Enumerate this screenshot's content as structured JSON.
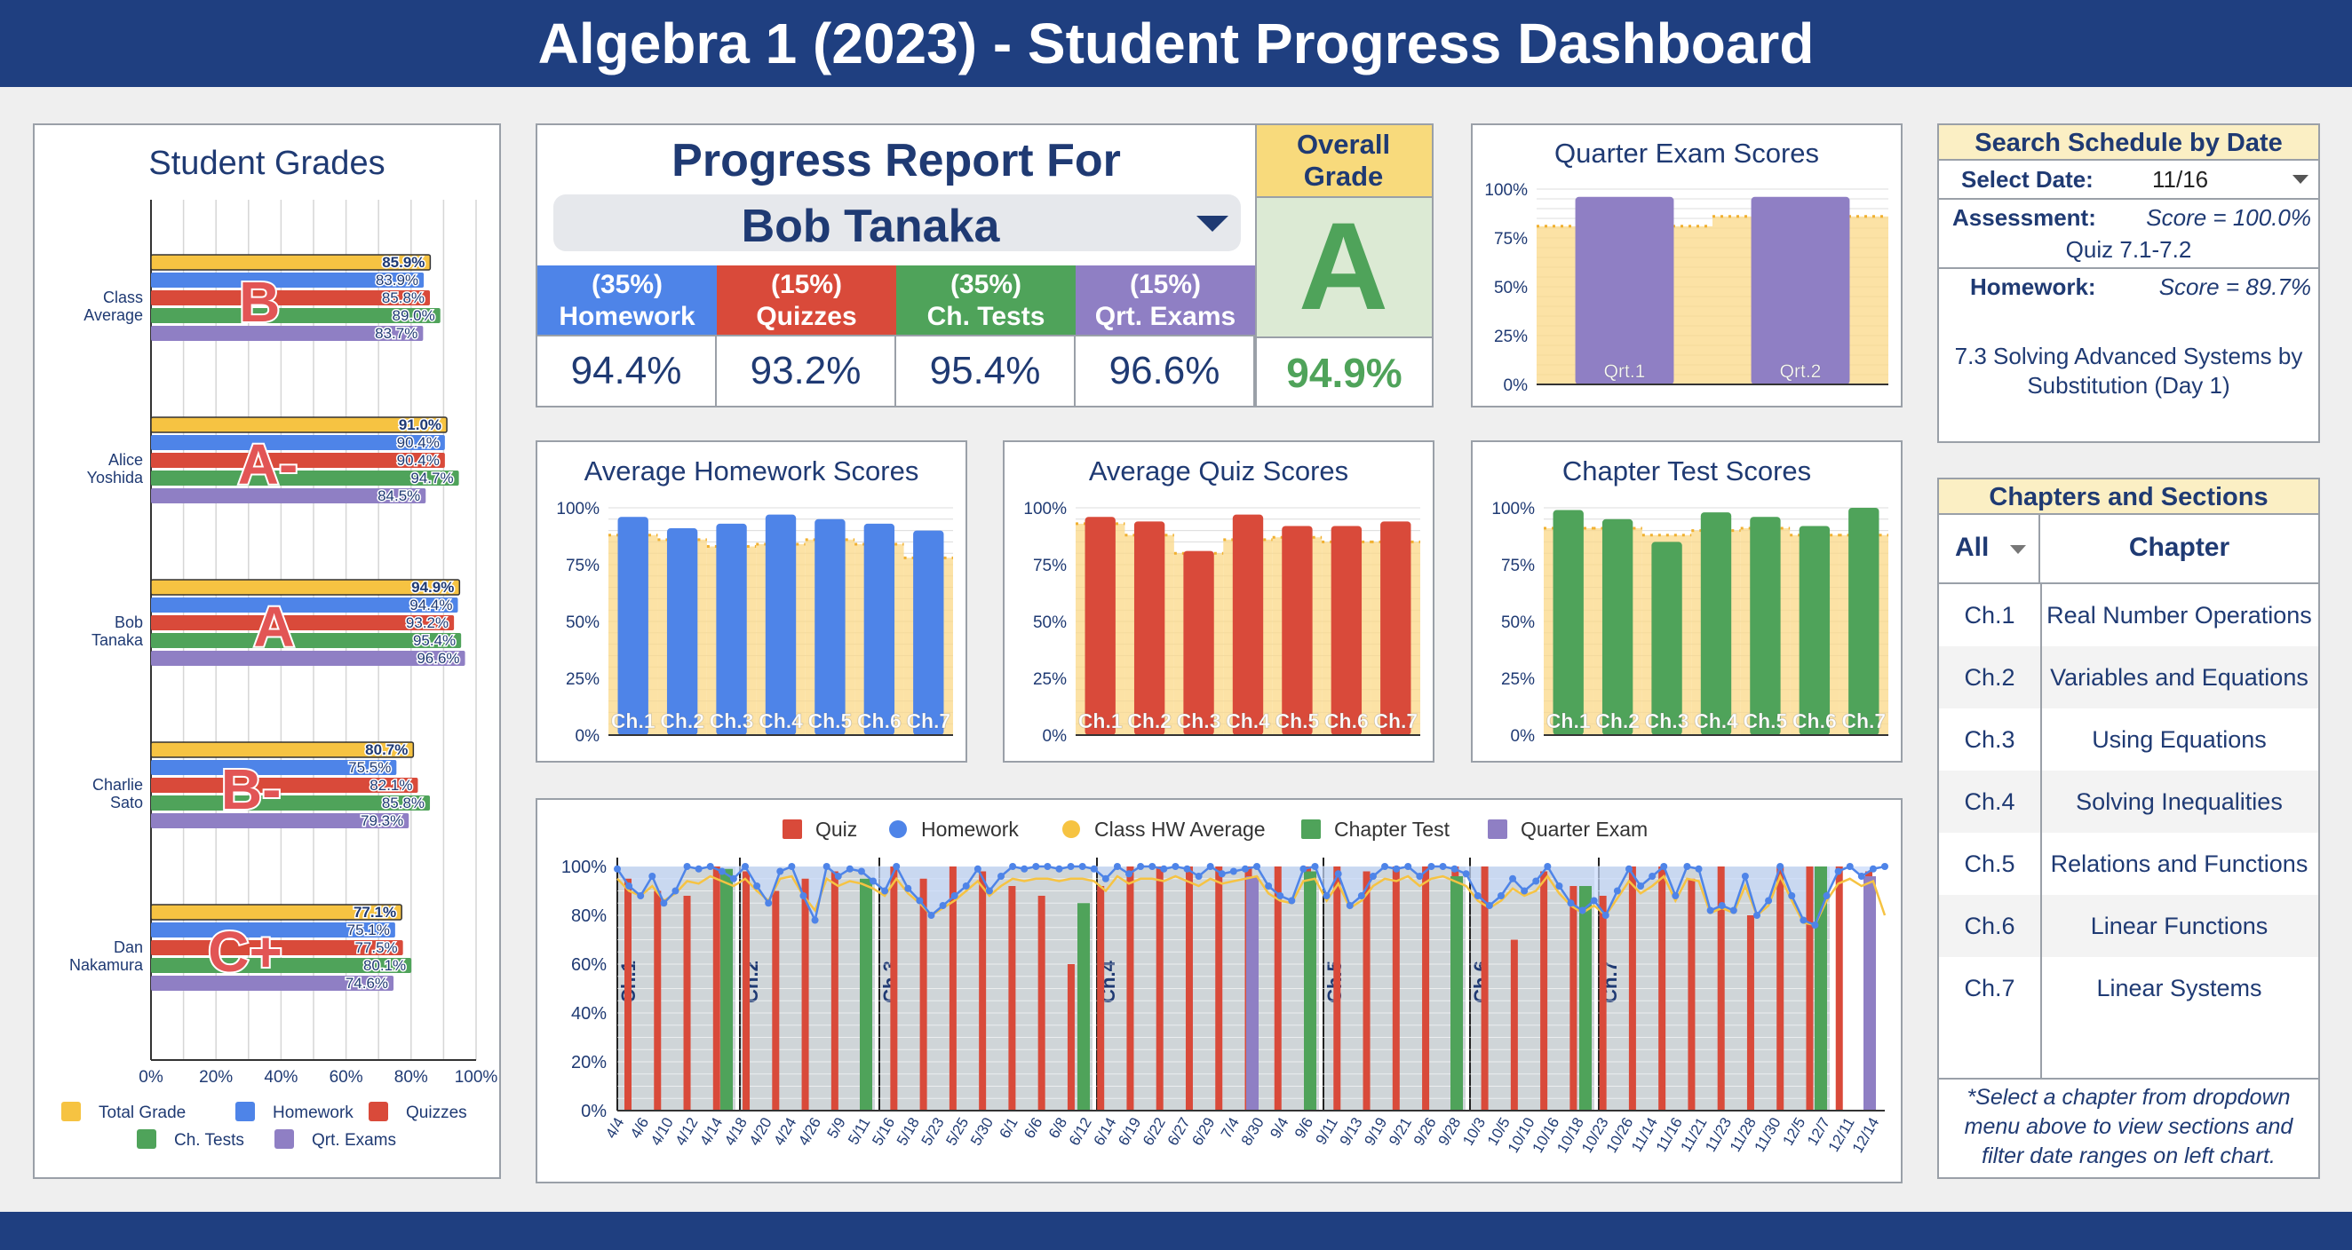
{
  "title": "Algebra 1 (2023) - Student Progress Dashboard",
  "grades_panel": {
    "title": "Student Grades",
    "students": [
      {
        "name": [
          "Class",
          "Average"
        ],
        "letter": "B",
        "values": [
          85.9,
          83.9,
          85.8,
          89.0,
          83.7
        ]
      },
      {
        "name": [
          "Alice",
          "Yoshida"
        ],
        "letter": "A-",
        "values": [
          91.0,
          90.4,
          90.4,
          94.7,
          84.5
        ]
      },
      {
        "name": [
          "Bob",
          "Tanaka"
        ],
        "letter": "A",
        "values": [
          94.9,
          94.4,
          93.2,
          95.4,
          96.6
        ]
      },
      {
        "name": [
          "Charlie",
          "Sato"
        ],
        "letter": "B-",
        "values": [
          80.7,
          75.5,
          82.1,
          85.8,
          79.3
        ]
      },
      {
        "name": [
          "Dan",
          "Nakamura"
        ],
        "letter": "C+",
        "values": [
          77.1,
          75.1,
          77.5,
          80.1,
          74.6
        ]
      }
    ],
    "axis_ticks": [
      "0%",
      "20%",
      "40%",
      "60%",
      "80%",
      "100%"
    ],
    "legend": [
      "Total Grade",
      "Homework",
      "Quizzes",
      "Ch. Tests",
      "Qrt. Exams"
    ]
  },
  "progress": {
    "title": "Progress Report For",
    "student": "Bob Tanaka",
    "overall_label": "Overall Grade",
    "overall_letter": "A",
    "overall_pct": "94.9%",
    "categories": [
      {
        "weight": "(35%)",
        "name": "Homework",
        "pct": "94.4%"
      },
      {
        "weight": "(15%)",
        "name": "Quizzes",
        "pct": "93.2%"
      },
      {
        "weight": "(35%)",
        "name": "Ch. Tests",
        "pct": "95.4%"
      },
      {
        "weight": "(15%)",
        "name": "Qrt. Exams",
        "pct": "96.6%"
      }
    ]
  },
  "schedule": {
    "title": "Search Schedule by Date",
    "select_label": "Select Date:",
    "select_value": "11/16",
    "assessment_label": "Assessment:",
    "assessment_score": "Score = 100.0%",
    "assessment_name": "Quiz 7.1-7.2",
    "homework_label": "Homework:",
    "homework_score": "Score = 89.7%",
    "homework_name": "7.3 Solving Advanced Systems by Substitution (Day 1)"
  },
  "chapters": {
    "title": "Chapters and Sections",
    "filter": "All",
    "col": "Chapter",
    "rows": [
      {
        "id": "Ch.1",
        "name": "Real Number Operations"
      },
      {
        "id": "Ch.2",
        "name": "Variables and Equations"
      },
      {
        "id": "Ch.3",
        "name": "Using Equations"
      },
      {
        "id": "Ch.4",
        "name": "Solving Inequalities"
      },
      {
        "id": "Ch.5",
        "name": "Relations and Functions"
      },
      {
        "id": "Ch.6",
        "name": "Linear Functions"
      },
      {
        "id": "Ch.7",
        "name": "Linear Systems"
      }
    ],
    "note": "*Select a chapter from dropdown menu above to view sections and filter date ranges on left chart."
  },
  "colors": {
    "total": "#f6c342",
    "homework": "#4e84e8",
    "quiz": "#d94a3a",
    "test": "#4fa35a",
    "exam": "#8f7fc4",
    "navy": "#1f3f80"
  },
  "chart_data": [
    {
      "type": "bar",
      "title": "Student Grades",
      "orientation": "horizontal",
      "categories": [
        "Class Average",
        "Alice Yoshida",
        "Bob Tanaka",
        "Charlie Sato",
        "Dan Nakamura"
      ],
      "series": [
        {
          "name": "Total Grade",
          "values": [
            85.9,
            91.0,
            94.9,
            80.7,
            77.1
          ]
        },
        {
          "name": "Homework",
          "values": [
            83.9,
            90.4,
            94.4,
            75.5,
            75.1
          ]
        },
        {
          "name": "Quizzes",
          "values": [
            85.8,
            90.4,
            93.2,
            82.1,
            77.5
          ]
        },
        {
          "name": "Ch. Tests",
          "values": [
            89.0,
            94.7,
            95.4,
            85.8,
            80.1
          ]
        },
        {
          "name": "Qrt. Exams",
          "values": [
            83.7,
            84.5,
            96.6,
            79.3,
            74.6
          ]
        }
      ],
      "xlim": [
        0,
        100
      ]
    },
    {
      "type": "bar",
      "title": "Quarter Exam Scores",
      "categories": [
        "Qrt.1",
        "Qrt.2"
      ],
      "values": [
        96,
        96
      ],
      "class_avg": [
        81,
        86
      ],
      "ylim": [
        0,
        100
      ]
    },
    {
      "type": "bar",
      "title": "Average Homework Scores",
      "categories": [
        "Ch.1",
        "Ch.2",
        "Ch.3",
        "Ch.4",
        "Ch.5",
        "Ch.6",
        "Ch.7"
      ],
      "values": [
        96,
        91,
        93,
        97,
        95,
        93,
        90
      ],
      "class_avg": [
        88,
        86,
        83,
        84,
        86,
        84,
        78
      ],
      "ylim": [
        0,
        100
      ]
    },
    {
      "type": "bar",
      "title": "Average Quiz Scores",
      "categories": [
        "Ch.1",
        "Ch.2",
        "Ch.3",
        "Ch.4",
        "Ch.5",
        "Ch.6",
        "Ch.7"
      ],
      "values": [
        96,
        94,
        81,
        97,
        92,
        92,
        94
      ],
      "class_avg": [
        93,
        88,
        80,
        86,
        87,
        85,
        85
      ],
      "ylim": [
        0,
        100
      ]
    },
    {
      "type": "bar",
      "title": "Chapter Test Scores",
      "categories": [
        "Ch.1",
        "Ch.2",
        "Ch.3",
        "Ch.4",
        "Ch.5",
        "Ch.6",
        "Ch.7"
      ],
      "values": [
        99,
        95,
        85,
        98,
        96,
        92,
        100
      ],
      "class_avg": [
        91,
        91,
        88,
        90,
        91,
        88,
        88
      ],
      "ylim": [
        0,
        100
      ]
    },
    {
      "type": "line",
      "title": "",
      "legend": [
        "Quiz",
        "Homework",
        "Class HW Average",
        "Chapter Test",
        "Quarter Exam"
      ],
      "x_ticks": [
        "4/4",
        "4/6",
        "4/10",
        "4/12",
        "4/14",
        "4/18",
        "4/20",
        "4/24",
        "4/26",
        "5/9",
        "5/11",
        "5/16",
        "5/18",
        "5/23",
        "5/25",
        "5/30",
        "6/1",
        "6/6",
        "6/8",
        "6/12",
        "6/14",
        "6/19",
        "6/22",
        "6/27",
        "6/29",
        "7/4",
        "8/30",
        "9/4",
        "9/6",
        "9/11",
        "9/13",
        "9/19",
        "9/21",
        "9/26",
        "9/28",
        "10/3",
        "10/5",
        "10/10",
        "10/16",
        "10/18",
        "10/23",
        "10/26",
        "11/14",
        "11/16",
        "11/21",
        "11/23",
        "11/28",
        "11/30",
        "12/5",
        "12/7",
        "12/11",
        "12/14"
      ],
      "y_ticks": [
        "0%",
        "20%",
        "40%",
        "60%",
        "80%",
        "100%"
      ],
      "ylim": [
        0,
        100
      ],
      "chapter_labels": [
        "Ch.1",
        "Ch.2",
        "Ch.3",
        "Ch.4",
        "Ch.5",
        "Ch.6",
        "Ch.7"
      ],
      "homework": [
        99,
        92,
        88,
        96,
        85,
        90,
        100,
        99,
        100,
        98,
        95,
        100,
        92,
        85,
        98,
        100,
        88,
        78,
        100,
        96,
        99,
        98,
        94,
        90,
        100,
        91,
        86,
        80,
        84,
        88,
        92,
        99,
        90,
        96,
        100,
        99,
        100,
        100,
        99,
        100,
        100,
        99,
        95,
        100,
        97,
        100,
        100,
        99,
        100,
        99,
        96,
        100,
        97,
        98,
        99,
        100,
        92,
        88,
        86,
        99,
        100,
        88,
        97,
        84,
        88,
        96,
        100,
        99,
        100,
        96,
        100,
        100,
        99,
        97,
        88,
        84,
        88,
        95,
        90,
        94,
        100,
        92,
        85,
        82,
        86,
        80,
        90,
        99,
        92,
        96,
        100,
        88,
        100,
        99,
        82,
        84,
        82,
        96,
        80,
        86,
        100,
        88,
        78,
        76,
        88,
        98,
        100,
        96,
        99,
        100
      ],
      "class_hw": [
        95,
        90,
        88,
        92,
        86,
        89,
        94,
        93,
        96,
        94,
        92,
        95,
        90,
        86,
        95,
        96,
        88,
        82,
        95,
        92,
        94,
        93,
        91,
        88,
        95,
        89,
        85,
        80,
        83,
        86,
        90,
        94,
        88,
        92,
        95,
        94,
        95,
        95,
        94,
        95,
        95,
        94,
        90,
        96,
        93,
        95,
        95,
        94,
        96,
        94,
        92,
        95,
        93,
        94,
        95,
        96,
        89,
        86,
        85,
        94,
        95,
        86,
        93,
        83,
        86,
        92,
        95,
        94,
        96,
        92,
        95,
        96,
        94,
        92,
        86,
        83,
        86,
        91,
        88,
        90,
        96,
        89,
        84,
        81,
        84,
        80,
        87,
        94,
        89,
        92,
        96,
        86,
        95,
        94,
        81,
        83,
        81,
        92,
        80,
        84,
        96,
        86,
        77,
        76,
        86,
        93,
        95,
        92,
        94,
        80
      ],
      "quiz": [
        95,
        90,
        88,
        100,
        98,
        90,
        95,
        98,
        85,
        100,
        95,
        100,
        98,
        92,
        88,
        60,
        92,
        100,
        100,
        100,
        100,
        100,
        100,
        100,
        100,
        98,
        100,
        100,
        100,
        100,
        70,
        98,
        92,
        88,
        100,
        100,
        95,
        100,
        80,
        100,
        100,
        100,
        98
      ],
      "chapter_test": [
        99,
        95,
        85,
        98,
        96,
        92,
        100
      ],
      "quarter_exam": [
        96,
        96
      ]
    }
  ]
}
